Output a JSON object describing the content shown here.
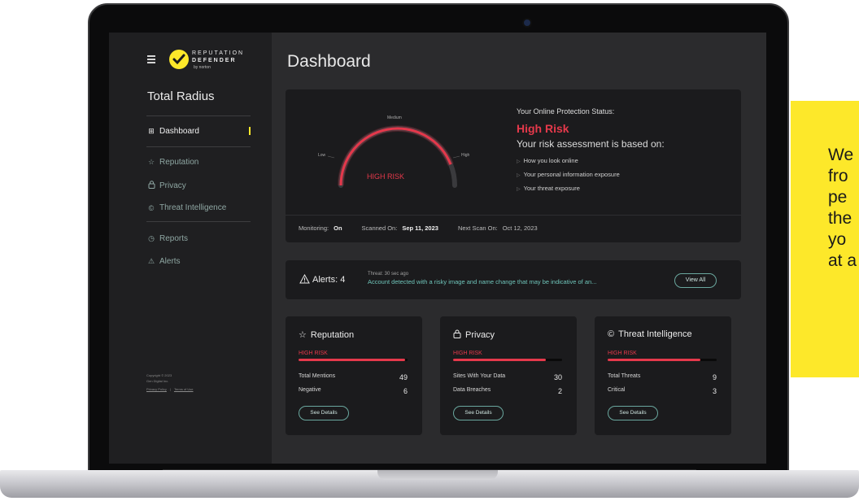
{
  "sidebar": {
    "logo": {
      "line1": "REPUTATION",
      "line2": "DEFENDER",
      "line3": "by norton"
    },
    "brand_title": "Total Radius",
    "items": [
      {
        "label": "Dashboard",
        "icon": "grid-icon"
      },
      {
        "label": "Reputation",
        "icon": "star-icon"
      },
      {
        "label": "Privacy",
        "icon": "lock-icon"
      },
      {
        "label": "Threat Intelligence",
        "icon": "threat-icon"
      },
      {
        "label": "Reports",
        "icon": "clock-icon"
      },
      {
        "label": "Alerts",
        "icon": "warning-icon"
      }
    ],
    "copyright_1": "Copyright © 2023",
    "copyright_2": "Gen Digital Inc.",
    "privacy_link": "Privacy Policy",
    "separator": "|",
    "terms_link": "Terms of Use"
  },
  "header": {
    "title": "Dashboard"
  },
  "status": {
    "gauge": {
      "low": "Low",
      "medium": "Medium",
      "high": "High",
      "center": "HIGH RISK",
      "level": 0.88
    },
    "caption": "Your Online Protection Status:",
    "value": "High Risk",
    "assessment_title": "Your risk assessment is based on:",
    "bullets": [
      "How you look online",
      "Your personal information exposure",
      "Your threat exposure"
    ],
    "monitoring_label": "Monitoring:",
    "monitoring_value": "On",
    "scanned_label": "Scanned On:",
    "scanned_value": "Sep 11, 2023",
    "next_scan_label": "Next Scan On:",
    "next_scan_value": "Oct 12, 2023"
  },
  "alerts": {
    "label": "Alerts: 4",
    "meta": "Threat: 30 sec ago",
    "text": "Account detected with a risky image and name change that may be indicative of an...",
    "view_all": "View All"
  },
  "cards": [
    {
      "title": "Reputation",
      "icon": "star-icon",
      "risk": "HIGH RISK",
      "level": 0.98,
      "row1_label": "Total Mentions",
      "row1_value": "49",
      "row2_label": "Negative",
      "row2_value": "6",
      "button": "See Details"
    },
    {
      "title": "Privacy",
      "icon": "lock-icon",
      "risk": "HIGH RISK",
      "level": 0.85,
      "row1_label": "Sites With Your Data",
      "row1_value": "30",
      "row2_label": "Data Breaches",
      "row2_value": "2",
      "button": "See Details"
    },
    {
      "title": "Threat Intelligence",
      "icon": "threat-icon",
      "risk": "HIGH RISK",
      "level": 0.85,
      "row1_label": "Total Threats",
      "row1_value": "9",
      "row2_label": "Critical",
      "row2_value": "3",
      "button": "See Details"
    }
  ],
  "side_card": {
    "lines": [
      "We",
      "fro",
      "pe",
      "the",
      "yo",
      "at a"
    ],
    "color": "#fde82a"
  },
  "colors": {
    "risk": "#e5394b",
    "accent": "#fde82a",
    "teal": "#6ec3b8"
  }
}
